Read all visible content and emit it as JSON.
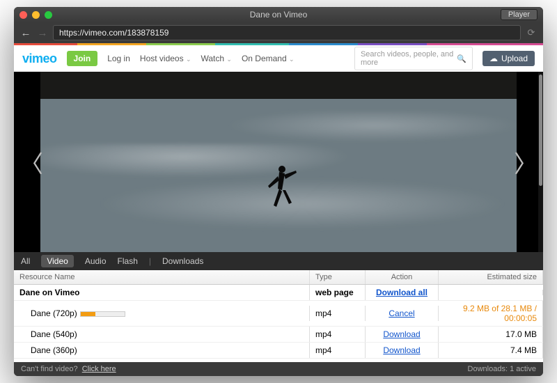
{
  "window": {
    "title": "Dane on Vimeo",
    "player_button": "Player"
  },
  "url": "https://vimeo.com/183878159",
  "vimeo": {
    "logo": "vimeo",
    "join": "Join",
    "nav": [
      "Log in",
      "Host videos",
      "Watch",
      "On Demand"
    ],
    "search_placeholder": "Search videos, people, and more",
    "upload": "Upload"
  },
  "panel": {
    "tabs": [
      "All",
      "Video",
      "Audio",
      "Flash"
    ],
    "downloads_label": "Downloads",
    "active_tab": "Video",
    "columns": {
      "name": "Resource Name",
      "type": "Type",
      "action": "Action",
      "size": "Estimated size"
    }
  },
  "rows": [
    {
      "name": "Dane on Vimeo",
      "type": "web page",
      "action": "Download all",
      "size": "",
      "head": true
    },
    {
      "name": "Dane (720p)",
      "type": "mp4",
      "action": "Cancel",
      "size": "9.2 MB of 28.1 MB / 00:00:05",
      "progress": true,
      "indent": true,
      "orange": true
    },
    {
      "name": "Dane (540p)",
      "type": "mp4",
      "action": "Download",
      "size": "17.0 MB",
      "indent": true
    },
    {
      "name": "Dane (360p)",
      "type": "mp4",
      "action": "Download",
      "size": "7.4 MB",
      "indent": true
    }
  ],
  "status": {
    "left_label": "Can't find video?",
    "left_link": "Click here",
    "right": "Downloads: 1 active"
  }
}
